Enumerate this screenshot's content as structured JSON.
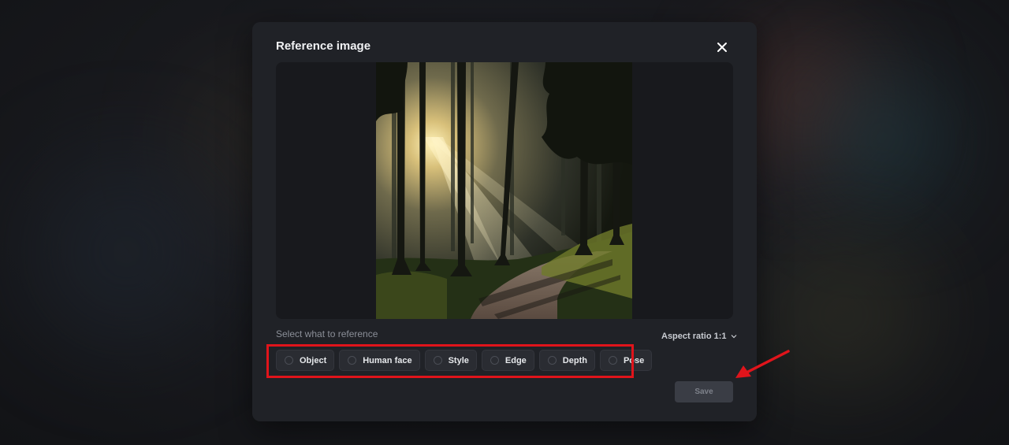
{
  "modal": {
    "title": "Reference image",
    "image": {
      "name": "forest-sunlight-image",
      "description": "Sunlit forest path with tall pine trees"
    },
    "select_label": "Select what to reference",
    "aspect_ratio_label": "Aspect ratio 1:1",
    "options": [
      {
        "label": "Object",
        "selected": false
      },
      {
        "label": "Human face",
        "selected": false
      },
      {
        "label": "Style",
        "selected": false
      },
      {
        "label": "Edge",
        "selected": false
      },
      {
        "label": "Depth",
        "selected": false
      },
      {
        "label": "Pose",
        "selected": false
      }
    ],
    "save_label": "Save",
    "save_disabled": true
  },
  "annotations": {
    "highlight_color": "#e0141b",
    "arrow_color": "#e0141b"
  },
  "icons": {
    "close": "close-icon",
    "chevron": "chevron-down-icon",
    "radio": "radio-icon"
  }
}
